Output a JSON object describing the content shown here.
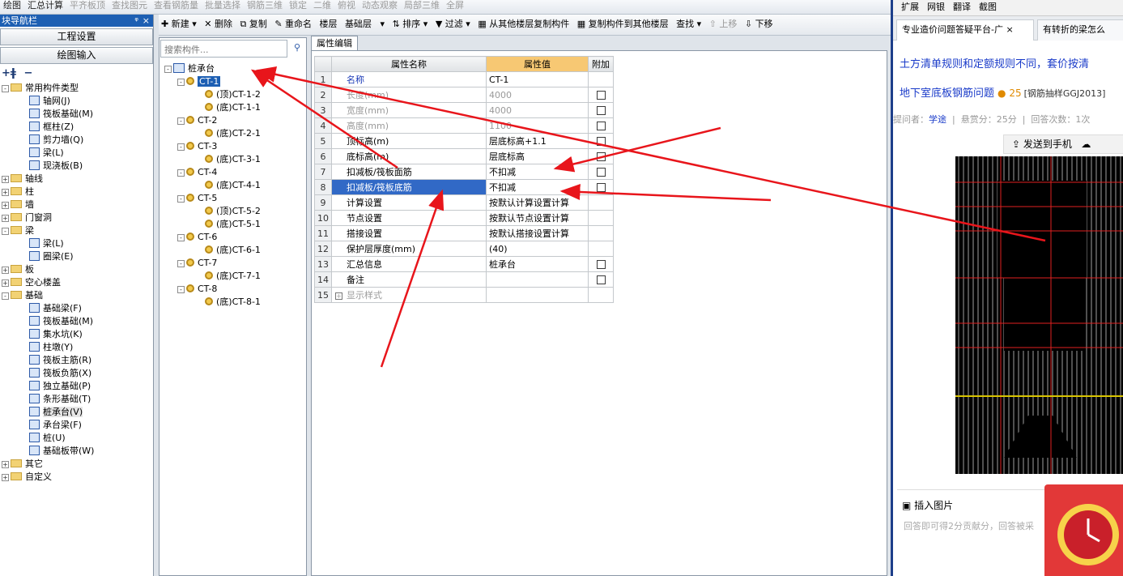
{
  "toolbar1": {
    "items": [
      "绘图",
      "汇总计算",
      "平齐板顶",
      "查找图元",
      "查看钢筋量",
      "批量选择",
      "钢筋三维",
      "锁定",
      "二维",
      "俯视",
      "动态观察",
      "局部三维",
      "全屏"
    ]
  },
  "leftnav": {
    "title": "块导航栏",
    "pin": "ᵠ",
    "close": "×",
    "btn_settings": "工程设置",
    "btn_drawing": "绘图输入",
    "tree": [
      {
        "label": "常用构件类型",
        "level": 0,
        "exp": "-",
        "kind": "folder"
      },
      {
        "label": "轴网(J)",
        "level": 1,
        "kind": "comp"
      },
      {
        "label": "筏板基础(M)",
        "level": 1,
        "kind": "comp"
      },
      {
        "label": "框柱(Z)",
        "level": 1,
        "kind": "comp"
      },
      {
        "label": "剪力墙(Q)",
        "level": 1,
        "kind": "comp"
      },
      {
        "label": "梁(L)",
        "level": 1,
        "kind": "comp"
      },
      {
        "label": "现浇板(B)",
        "level": 1,
        "kind": "comp"
      },
      {
        "label": "轴线",
        "level": 0,
        "exp": "+",
        "kind": "folder"
      },
      {
        "label": "柱",
        "level": 0,
        "exp": "+",
        "kind": "folder"
      },
      {
        "label": "墙",
        "level": 0,
        "exp": "+",
        "kind": "folder"
      },
      {
        "label": "门窗洞",
        "level": 0,
        "exp": "+",
        "kind": "folder"
      },
      {
        "label": "梁",
        "level": 0,
        "exp": "-",
        "kind": "folder"
      },
      {
        "label": "梁(L)",
        "level": 1,
        "kind": "comp"
      },
      {
        "label": "圈梁(E)",
        "level": 1,
        "kind": "comp"
      },
      {
        "label": "板",
        "level": 0,
        "exp": "+",
        "kind": "folder"
      },
      {
        "label": "空心楼盖",
        "level": 0,
        "exp": "+",
        "kind": "folder"
      },
      {
        "label": "基础",
        "level": 0,
        "exp": "-",
        "kind": "folder"
      },
      {
        "label": "基础梁(F)",
        "level": 1,
        "kind": "comp"
      },
      {
        "label": "筏板基础(M)",
        "level": 1,
        "kind": "comp"
      },
      {
        "label": "集水坑(K)",
        "level": 1,
        "kind": "comp"
      },
      {
        "label": "柱墩(Y)",
        "level": 1,
        "kind": "comp"
      },
      {
        "label": "筏板主筋(R)",
        "level": 1,
        "kind": "comp"
      },
      {
        "label": "筏板负筋(X)",
        "level": 1,
        "kind": "comp"
      },
      {
        "label": "独立基础(P)",
        "level": 1,
        "kind": "comp"
      },
      {
        "label": "条形基础(T)",
        "level": 1,
        "kind": "comp"
      },
      {
        "label": "桩承台(V)",
        "level": 1,
        "kind": "comp",
        "selected": true
      },
      {
        "label": "承台梁(F)",
        "level": 1,
        "kind": "comp"
      },
      {
        "label": "桩(U)",
        "level": 1,
        "kind": "comp"
      },
      {
        "label": "基础板带(W)",
        "level": 1,
        "kind": "comp"
      },
      {
        "label": "其它",
        "level": 0,
        "exp": "+",
        "kind": "folder"
      },
      {
        "label": "自定义",
        "level": 0,
        "exp": "+",
        "kind": "folder"
      }
    ]
  },
  "toolbar2": {
    "new": "新建",
    "delete": "删除",
    "copy": "复制",
    "rename": "重命名",
    "floor": "楼层",
    "floor_value": "基础层",
    "sort": "排序",
    "filter": "过滤",
    "copy_from": "从其他楼层复制构件",
    "copy_to": "复制构件到其他楼层",
    "find": "查找",
    "move_up": "上移",
    "move_down": "下移"
  },
  "search": {
    "placeholder": "搜索构件..."
  },
  "components": {
    "root": "桩承台",
    "items": [
      {
        "label": "CT-1",
        "level": 1,
        "selected": true
      },
      {
        "label": "(顶)CT-1-2",
        "level": 2
      },
      {
        "label": "(底)CT-1-1",
        "level": 2
      },
      {
        "label": "CT-2",
        "level": 1
      },
      {
        "label": "(底)CT-2-1",
        "level": 2
      },
      {
        "label": "CT-3",
        "level": 1
      },
      {
        "label": "(底)CT-3-1",
        "level": 2
      },
      {
        "label": "CT-4",
        "level": 1
      },
      {
        "label": "(底)CT-4-1",
        "level": 2
      },
      {
        "label": "CT-5",
        "level": 1
      },
      {
        "label": "(顶)CT-5-2",
        "level": 2
      },
      {
        "label": "(底)CT-5-1",
        "level": 2
      },
      {
        "label": "CT-6",
        "level": 1
      },
      {
        "label": "(底)CT-6-1",
        "level": 2
      },
      {
        "label": "CT-7",
        "level": 1
      },
      {
        "label": "(底)CT-7-1",
        "level": 2
      },
      {
        "label": "CT-8",
        "level": 1
      },
      {
        "label": "(底)CT-8-1",
        "level": 2
      }
    ]
  },
  "props": {
    "tab": "属性编辑",
    "headers": {
      "name": "属性名称",
      "value": "属性值",
      "extra": "附加"
    },
    "rows": [
      {
        "idx": "1",
        "name": "名称",
        "value": "CT-1",
        "style": "blue",
        "check": false
      },
      {
        "idx": "2",
        "name": "长度(mm)",
        "value": "4000",
        "style": "gray",
        "check": true
      },
      {
        "idx": "3",
        "name": "宽度(mm)",
        "value": "4000",
        "style": "gray",
        "check": true
      },
      {
        "idx": "4",
        "name": "高度(mm)",
        "value": "1100",
        "style": "gray",
        "check": true
      },
      {
        "idx": "5",
        "name": "顶标高(m)",
        "value": "层底标高+1.1",
        "style": "",
        "check": true
      },
      {
        "idx": "6",
        "name": "底标高(m)",
        "value": "层底标高",
        "style": "",
        "check": true
      },
      {
        "idx": "7",
        "name": "扣减板/筏板面筋",
        "value": "不扣减",
        "style": "",
        "check": true
      },
      {
        "idx": "8",
        "name": "扣减板/筏板底筋",
        "value": "不扣减",
        "style": "",
        "check": true,
        "selected": true
      },
      {
        "idx": "9",
        "name": "计算设置",
        "value": "按默认计算设置计算",
        "style": "",
        "check": false
      },
      {
        "idx": "10",
        "name": "节点设置",
        "value": "按默认节点设置计算",
        "style": "",
        "check": false
      },
      {
        "idx": "11",
        "name": "搭接设置",
        "value": "按默认搭接设置计算",
        "style": "",
        "check": false
      },
      {
        "idx": "12",
        "name": "保护层厚度(mm)",
        "value": "(40)",
        "style": "",
        "check": false
      },
      {
        "idx": "13",
        "name": "汇总信息",
        "value": "桩承台",
        "style": "",
        "check": true
      },
      {
        "idx": "14",
        "name": "备注",
        "value": "",
        "style": "",
        "check": true
      },
      {
        "idx": "15",
        "name": "显示样式",
        "value": "",
        "style": "gray",
        "check": false,
        "plus": true
      }
    ]
  },
  "browser": {
    "toolbar": [
      "扩展",
      "网银",
      "翻译",
      "截图"
    ],
    "tab1": "专业造价问题答疑平台-广",
    "tab2": "有转折的梁怎么",
    "link1": "土方清单规则和定额规则不同，套价按清",
    "link2_title": "地下室底板钢筋问题",
    "link2_points": "25",
    "link2_tag": "[钢筋抽样GGJ2013]",
    "meta_asker_label": "提问者：",
    "meta_asker": "学途",
    "meta_reward": "悬赏分：25分",
    "meta_answers": "回答次数：1次",
    "send_phone": "发送到手机",
    "insert_image": "插入图片",
    "answer_placeholder": "回答即可得2分贡献分，回答被采"
  },
  "colors": {
    "arrow": "#e8151b",
    "selection": "#3169c6",
    "nav_title": "#1d5fb3"
  }
}
